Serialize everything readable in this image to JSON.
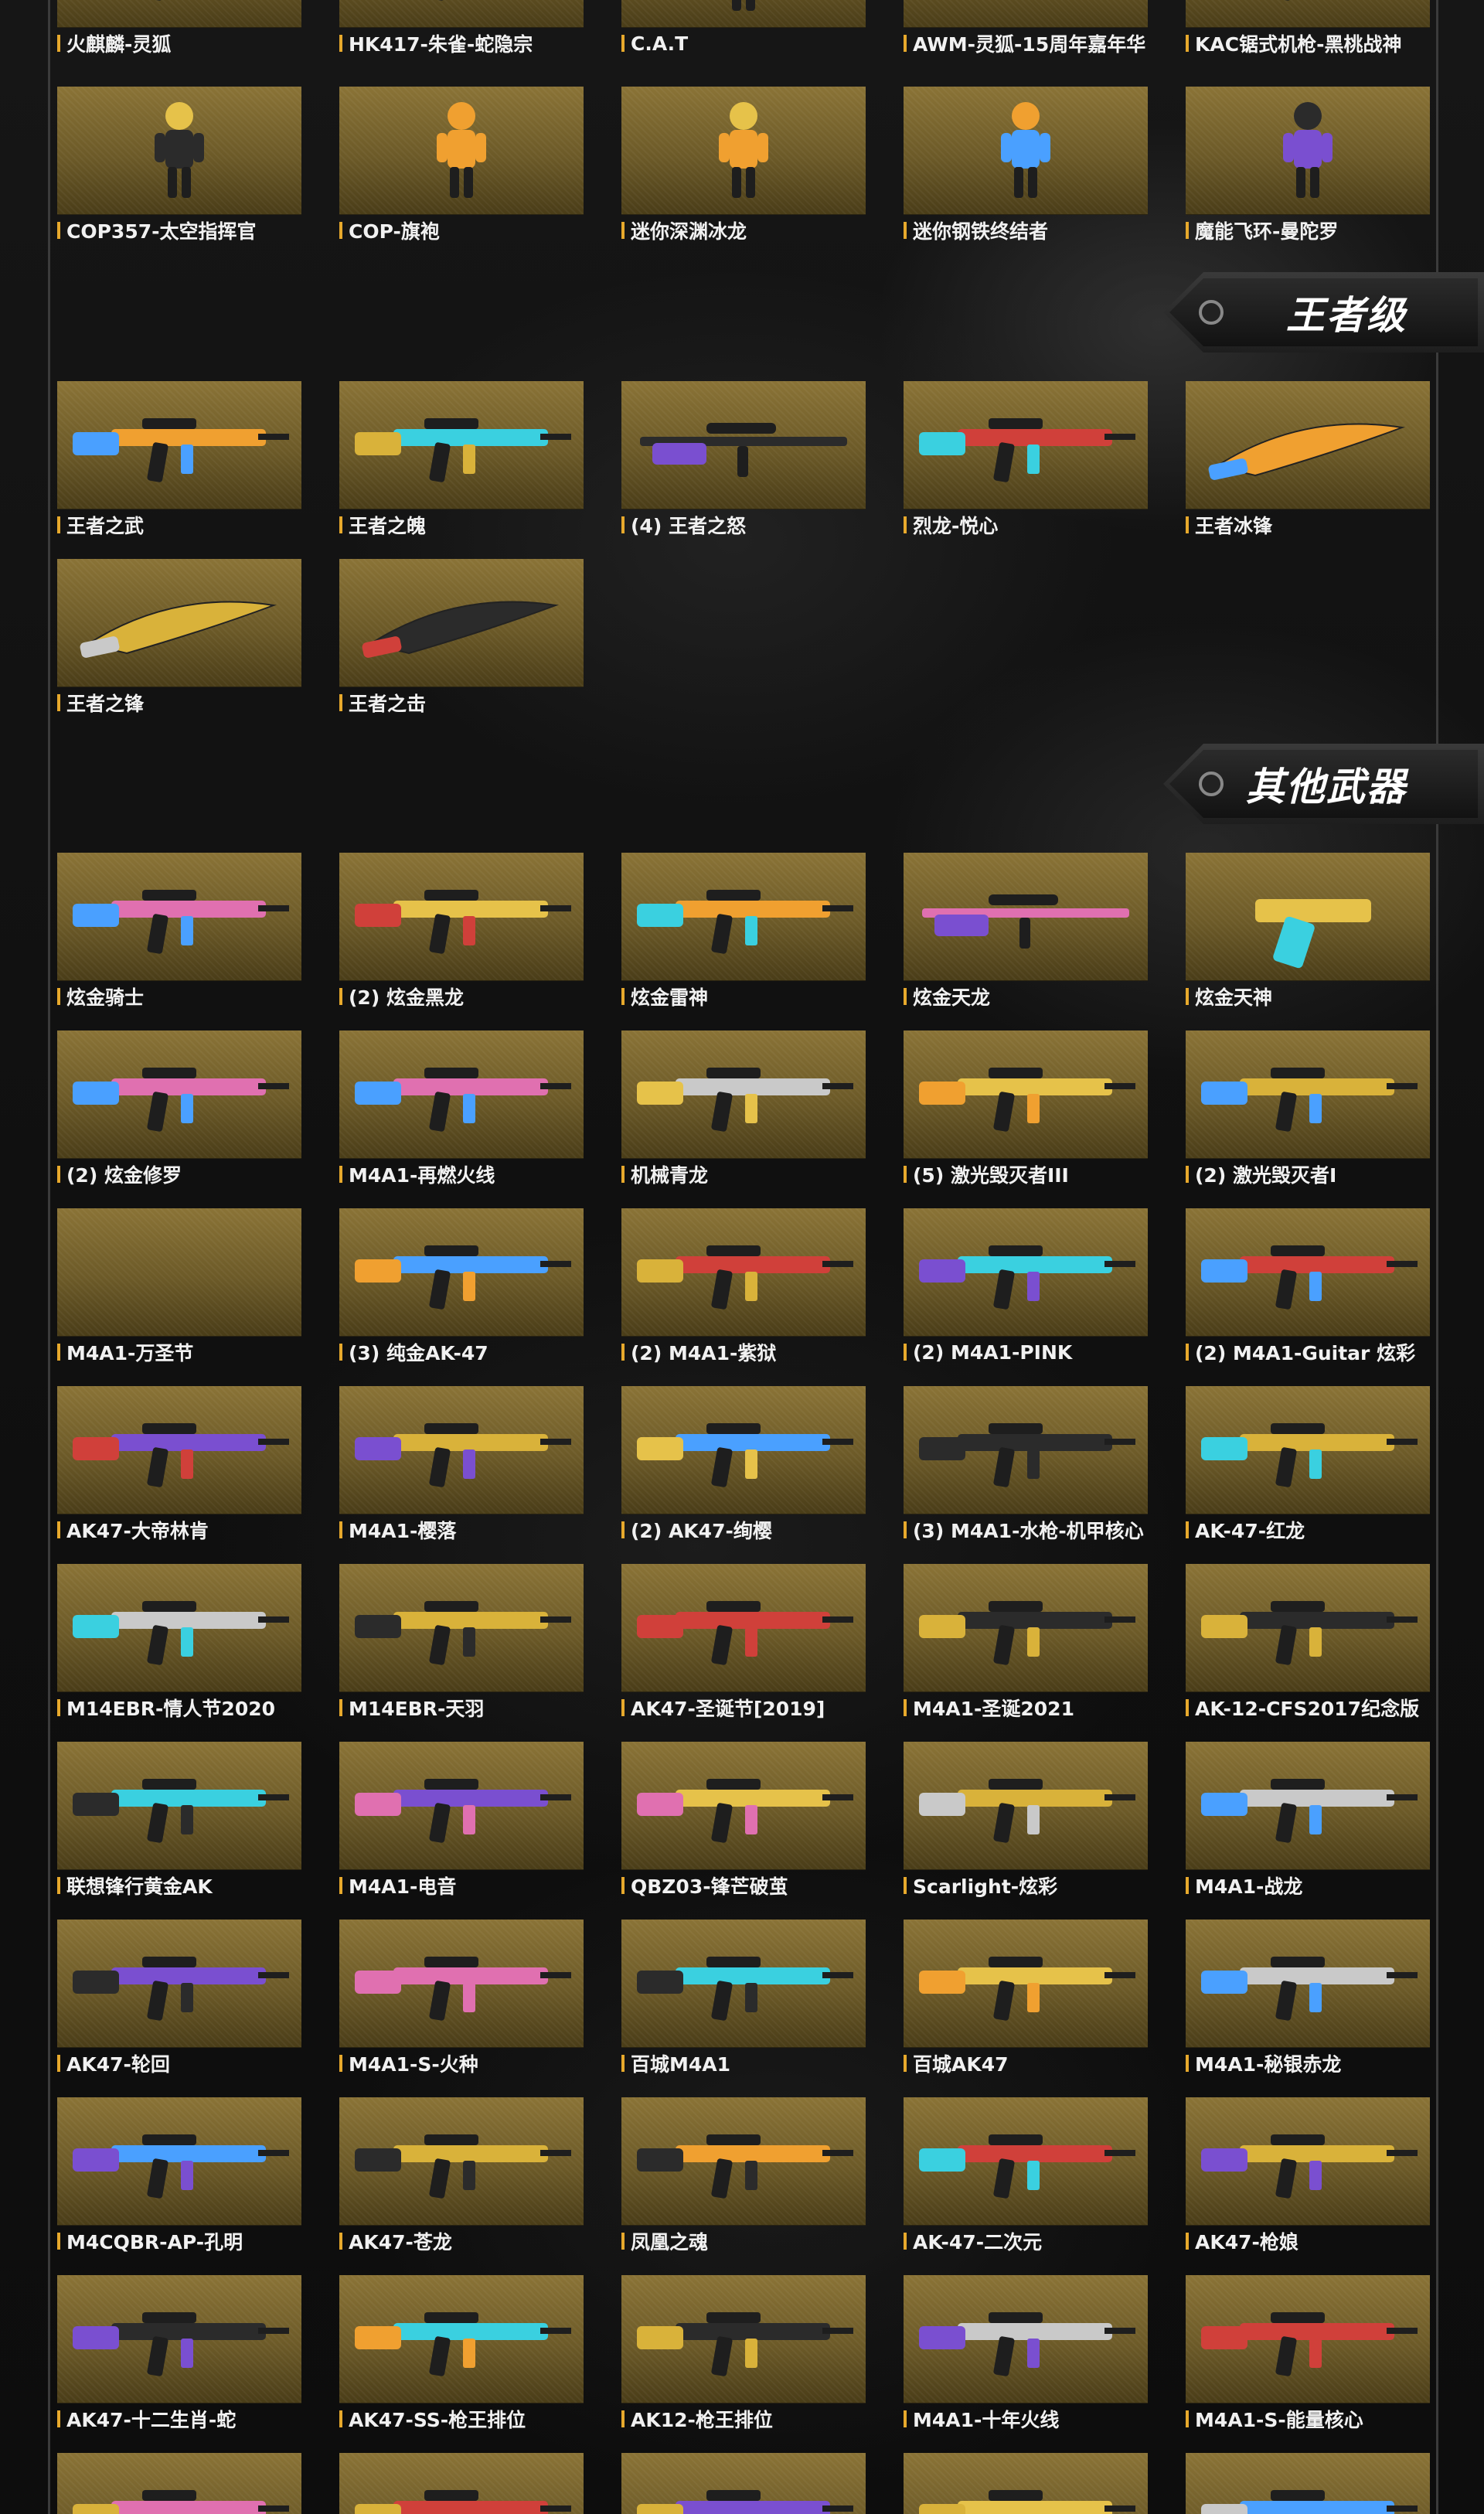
{
  "sections": [
    {
      "id": "top",
      "title": ""
    },
    {
      "id": "king",
      "title": "王者级"
    },
    {
      "id": "other",
      "title": "其他武器"
    }
  ],
  "cards": [
    {
      "label": "火麒麟-灵狐",
      "kind": "rifle"
    },
    {
      "label": "HK417-朱雀-蛇隐宗",
      "kind": "rifle"
    },
    {
      "label": "C.A.T",
      "kind": "figure"
    },
    {
      "label": "AWM-灵狐-15周年嘉年华",
      "kind": "sniper"
    },
    {
      "label": "KAC锯式机枪-黑桃战神",
      "kind": "rifle"
    },
    {
      "label": "COP357-太空指挥官",
      "kind": "figure"
    },
    {
      "label": "COP-旗袍",
      "kind": "figure"
    },
    {
      "label": "迷你深渊冰龙",
      "kind": "figure"
    },
    {
      "label": "迷你钢铁终结者",
      "kind": "figure"
    },
    {
      "label": "魔能飞环-曼陀罗",
      "kind": "figure"
    },
    {
      "label": "王者之武",
      "kind": "rifle"
    },
    {
      "label": "王者之魄",
      "kind": "rifle"
    },
    {
      "label": "(4) 王者之怒",
      "kind": "sniper"
    },
    {
      "label": "烈龙-悦心",
      "kind": "rifle"
    },
    {
      "label": "王者冰锋",
      "kind": "knife"
    },
    {
      "label": "王者之锋",
      "kind": "knife"
    },
    {
      "label": "王者之击",
      "kind": "knife"
    },
    {
      "label": "炫金骑士",
      "kind": "rifle"
    },
    {
      "label": "(2) 炫金黑龙",
      "kind": "rifle"
    },
    {
      "label": "炫金雷神",
      "kind": "rifle"
    },
    {
      "label": "炫金天龙",
      "kind": "sniper"
    },
    {
      "label": "炫金天神",
      "kind": "pistol"
    },
    {
      "label": "(2) 炫金修罗",
      "kind": "rifle"
    },
    {
      "label": "M4A1-再燃火线",
      "kind": "rifle"
    },
    {
      "label": "机械青龙",
      "kind": "rifle"
    },
    {
      "label": "(5) 激光毁灭者III",
      "kind": "rifle"
    },
    {
      "label": "(2) 激光毁灭者I",
      "kind": "rifle"
    },
    {
      "label": "M4A1-万圣节",
      "kind": "empty"
    },
    {
      "label": "(3) 纯金AK-47",
      "kind": "rifle"
    },
    {
      "label": "(2) M4A1-紫狱",
      "kind": "rifle"
    },
    {
      "label": "(2) M4A1-PINK",
      "kind": "rifle"
    },
    {
      "label": "(2) M4A1-Guitar 炫彩",
      "kind": "rifle"
    },
    {
      "label": "AK47-大帝林肯",
      "kind": "rifle"
    },
    {
      "label": "M4A1-樱落",
      "kind": "rifle"
    },
    {
      "label": "(2) AK47-绚樱",
      "kind": "rifle"
    },
    {
      "label": "(3) M4A1-水枪-机甲核心",
      "kind": "rifle"
    },
    {
      "label": "AK-47-红龙",
      "kind": "rifle"
    },
    {
      "label": "M14EBR-情人节2020",
      "kind": "rifle"
    },
    {
      "label": "M14EBR-天羽",
      "kind": "rifle"
    },
    {
      "label": "AK47-圣诞节[2019]",
      "kind": "rifle"
    },
    {
      "label": "M4A1-圣诞2021",
      "kind": "rifle"
    },
    {
      "label": "AK-12-CFS2017纪念版",
      "kind": "rifle"
    },
    {
      "label": "联想锋行黄金AK",
      "kind": "rifle"
    },
    {
      "label": "M4A1-电音",
      "kind": "rifle"
    },
    {
      "label": "QBZ03-锋芒破茧",
      "kind": "rifle"
    },
    {
      "label": "Scarlight-炫彩",
      "kind": "rifle"
    },
    {
      "label": "M4A1-战龙",
      "kind": "rifle"
    },
    {
      "label": "AK47-轮回",
      "kind": "rifle"
    },
    {
      "label": "M4A1-S-火种",
      "kind": "rifle"
    },
    {
      "label": "百城M4A1",
      "kind": "rifle"
    },
    {
      "label": "百城AK47",
      "kind": "rifle"
    },
    {
      "label": "M4A1-秘银赤龙",
      "kind": "rifle"
    },
    {
      "label": "M4CQBR-AP-孔明",
      "kind": "rifle"
    },
    {
      "label": "AK47-苍龙",
      "kind": "rifle"
    },
    {
      "label": "凤凰之魂",
      "kind": "rifle"
    },
    {
      "label": "AK-47-二次元",
      "kind": "rifle"
    },
    {
      "label": "AK47-枪娘",
      "kind": "rifle"
    },
    {
      "label": "AK47-十二生肖-蛇",
      "kind": "rifle"
    },
    {
      "label": "AK47-SS-枪王排位",
      "kind": "rifle"
    },
    {
      "label": "AK12-枪王排位",
      "kind": "rifle"
    },
    {
      "label": "M4A1-十年火线",
      "kind": "rifle"
    },
    {
      "label": "M4A1-S-能量核心",
      "kind": "rifle"
    },
    {
      "label": "",
      "kind": "rifle"
    },
    {
      "label": "",
      "kind": "rifle"
    },
    {
      "label": "",
      "kind": "rifle"
    },
    {
      "label": "",
      "kind": "rifle"
    },
    {
      "label": "",
      "kind": "rifle"
    }
  ],
  "colors": {
    "card_gold": "#7a6630",
    "label_accent": "#e7a92c",
    "gun_palette": [
      "#d9b23a",
      "#c9c9c9",
      "#2b2b2b",
      "#3ad0e0",
      "#e070b0",
      "#d0403a",
      "#7a4fd0",
      "#e6c24a",
      "#4aa0ff",
      "#f0a030"
    ]
  }
}
